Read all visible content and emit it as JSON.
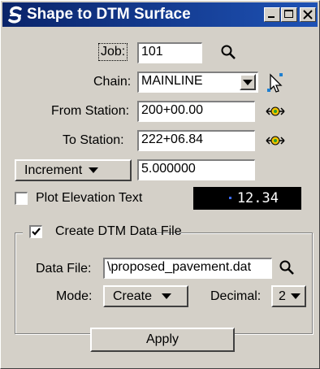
{
  "window": {
    "title": "Shape to DTM Surface"
  },
  "job": {
    "label": "Job:",
    "value": "101"
  },
  "chain": {
    "label": "Chain:",
    "value": "MAINLINE"
  },
  "from_station": {
    "label": "From Station:",
    "value": "200+00.00"
  },
  "to_station": {
    "label": "To Station:",
    "value": "222+06.84"
  },
  "increment": {
    "label": "Increment",
    "value": "5.000000"
  },
  "plot_elevation": {
    "label": "Plot Elevation Text",
    "checked": false,
    "sample": "12.34"
  },
  "dtm": {
    "label": "Create DTM Data File",
    "checked": true,
    "data_file_label": "Data File:",
    "data_file_value": "\\proposed_pavement.dat",
    "mode_label": "Mode:",
    "mode_value": "Create",
    "decimal_label": "Decimal:",
    "decimal_value": "2"
  },
  "apply_label": "Apply"
}
